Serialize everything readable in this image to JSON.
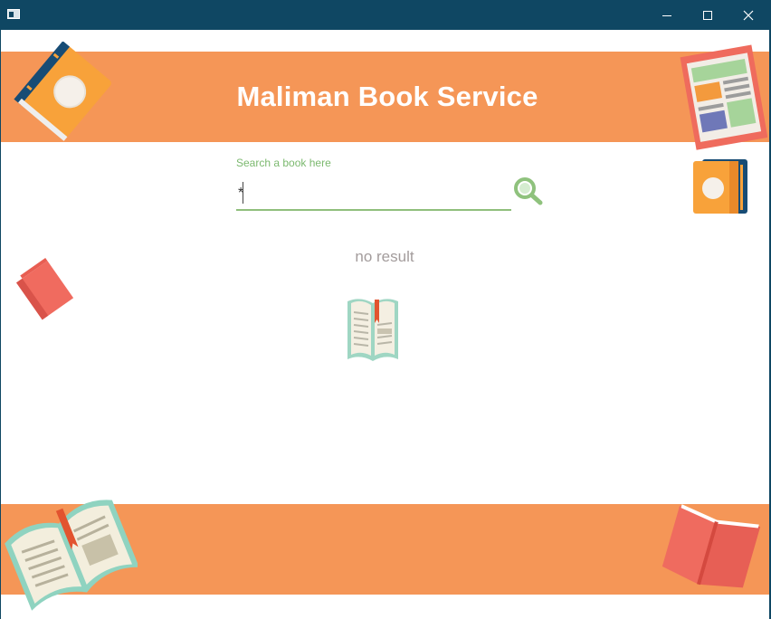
{
  "window": {
    "title": "",
    "minimize_label": "minimize",
    "maximize_label": "maximize",
    "close_label": "close"
  },
  "header": {
    "title": "Maliman Book Service"
  },
  "search": {
    "label": "Search a book here",
    "value": "*",
    "button_icon": "magnifier-icon"
  },
  "results": {
    "empty_text": "no result"
  },
  "colors": {
    "titlebar": "#0f4763",
    "band": "#f59657",
    "accent_green": "#7cb96f",
    "muted_text": "#a39c9c"
  }
}
